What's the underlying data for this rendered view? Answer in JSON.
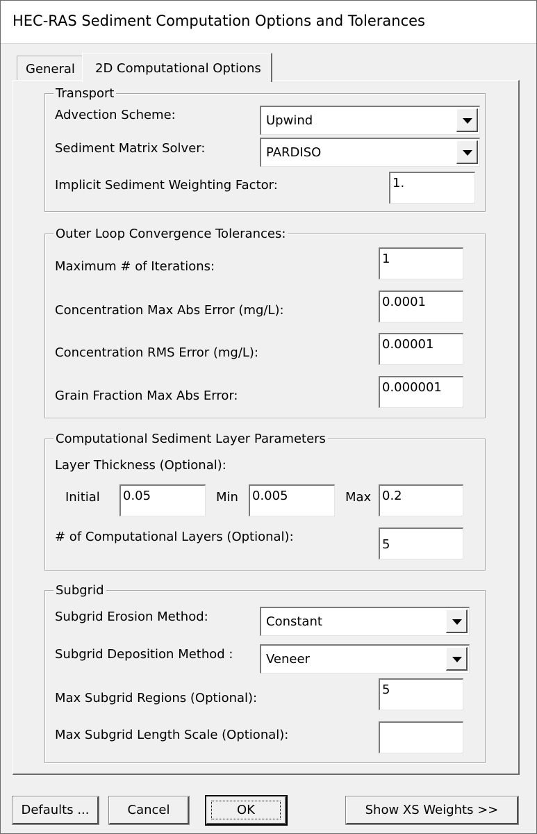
{
  "window": {
    "title": "HEC-RAS Sediment Computation Options and Tolerances"
  },
  "tabs": [
    {
      "label": "General",
      "active": false
    },
    {
      "label": "2D Computational Options",
      "active": true
    }
  ],
  "transport": {
    "legend": "Transport",
    "advection_label": "Advection Scheme:",
    "advection_value": "Upwind",
    "solver_label": "Sediment Matrix Solver:",
    "solver_value": "PARDISO",
    "implicit_label": "Implicit Sediment Weighting Factor:",
    "implicit_value": "1."
  },
  "outer_loop": {
    "legend": "Outer Loop Convergence Tolerances:",
    "max_iter_label": "Maximum # of Iterations:",
    "max_iter_value": "1",
    "conc_max_label": "Concentration Max Abs Error (mg/L):",
    "conc_max_value": "0.0001",
    "conc_rms_label": "Concentration RMS Error (mg/L):",
    "conc_rms_value": "0.00001",
    "grain_label": "Grain Fraction Max Abs Error:",
    "grain_value": "0.000001"
  },
  "layer": {
    "legend": "Computational Sediment Layer Parameters",
    "thickness_label": "Layer Thickness (Optional):",
    "initial_label": "Initial",
    "initial_value": "0.05",
    "min_label": "Min",
    "min_value": "0.005",
    "max_label": "Max",
    "max_value": "0.2",
    "layers_label": "# of Computational Layers (Optional):",
    "layers_value": "5"
  },
  "subgrid": {
    "legend": "Subgrid",
    "erosion_label": "Subgrid Erosion Method:",
    "erosion_value": "Constant",
    "deposition_label": "Subgrid Deposition Method :",
    "deposition_value": "Veneer",
    "regions_label": "Max Subgrid Regions (Optional):",
    "regions_value": "5",
    "length_label": "Max Subgrid Length Scale (Optional):",
    "length_value": ""
  },
  "buttons": {
    "defaults": "Defaults ...",
    "cancel": "Cancel",
    "ok": "OK",
    "show_xs": "Show XS Weights >>"
  },
  "icons": {
    "dropdown": "chevron-down-icon"
  }
}
